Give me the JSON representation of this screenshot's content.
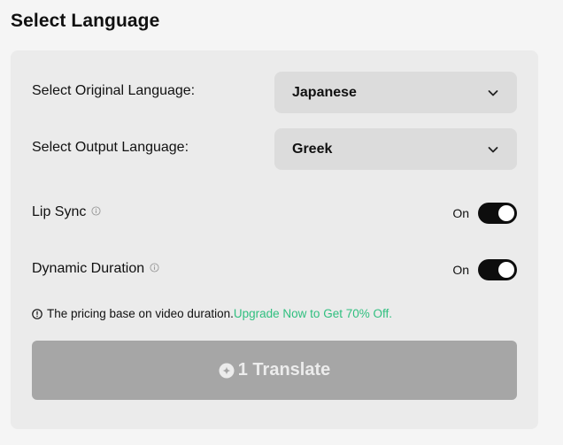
{
  "page": {
    "title": "Select Language"
  },
  "original_language": {
    "label": "Select Original Language:",
    "value": "Japanese"
  },
  "output_language": {
    "label": "Select Output Language:",
    "value": "Greek"
  },
  "lip_sync": {
    "label": "Lip Sync",
    "state_text": "On",
    "enabled": true
  },
  "dynamic_duration": {
    "label": "Dynamic Duration",
    "state_text": "On",
    "enabled": true
  },
  "notice": {
    "text": "The pricing base on video duration.",
    "link": "Upgrade Now to Get 70% Off."
  },
  "translate_button": {
    "count": "1",
    "label": "Translate"
  },
  "colors": {
    "accent_link": "#2fbf7f",
    "toggle_on": "#0d0d0d",
    "button_disabled": "#a6a6a6",
    "panel_bg": "#ebebeb",
    "select_bg": "#dcdcdc"
  },
  "icons": [
    "chevron-down-icon",
    "info-icon",
    "alert-circle-icon",
    "plus-circle-icon"
  ]
}
